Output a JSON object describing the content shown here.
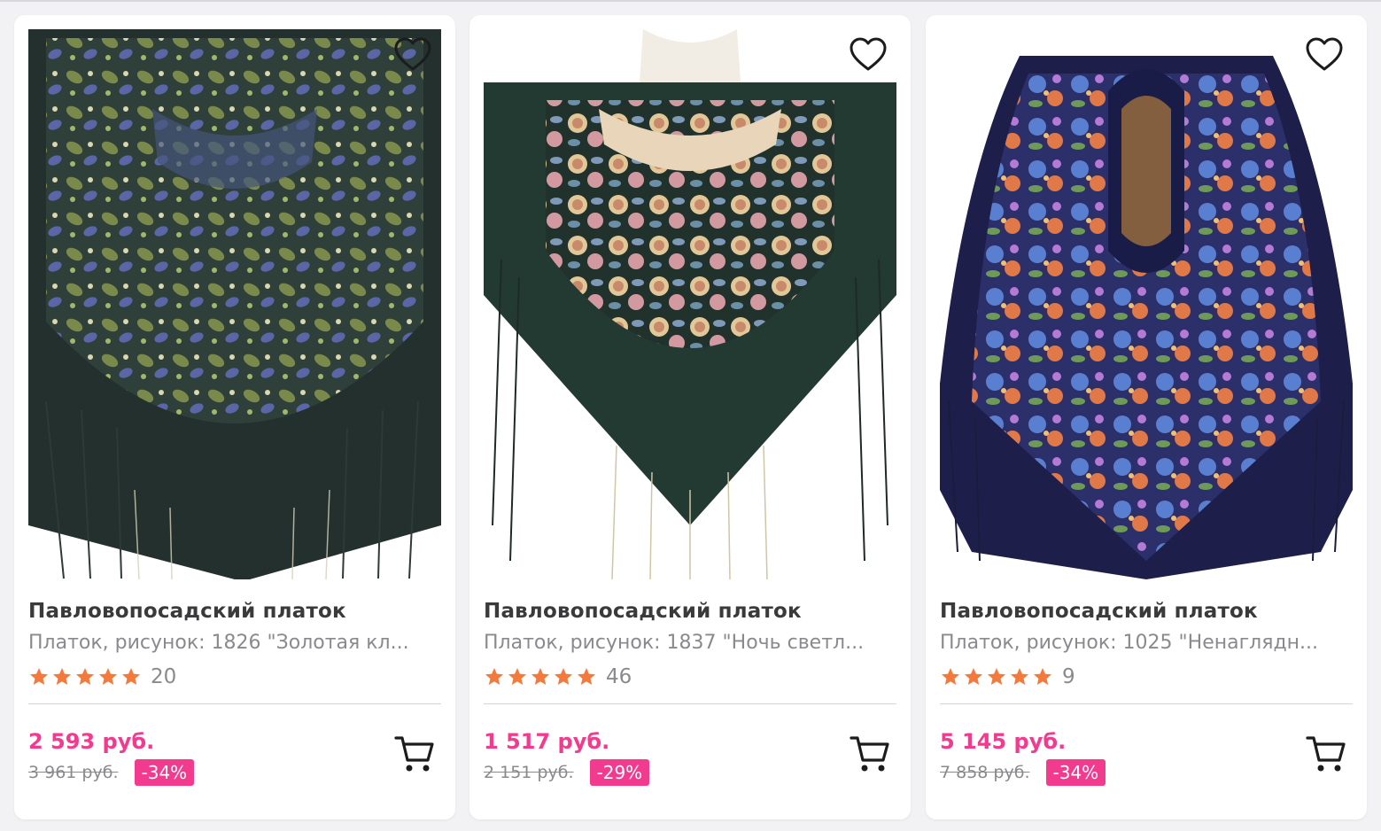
{
  "accent_color": "#f23a8f",
  "star_color": "#f47a3c",
  "products": [
    {
      "title": "Павловопосадский платок",
      "subtitle": "Платок, рисунок: 1826 \"Золотая кл...",
      "rating": 5,
      "reviews": "20",
      "price": "2 593 руб.",
      "old_price": "3 961 руб.",
      "discount": "-34%",
      "image_icon": "shawl-photo",
      "favorite_icon": "heart-icon",
      "cart_icon": "cart-icon"
    },
    {
      "title": "Павловопосадский платок",
      "subtitle": "Платок, рисунок: 1837 \"Ночь светл...",
      "rating": 5,
      "reviews": "46",
      "price": "1 517 руб.",
      "old_price": "2 151 руб.",
      "discount": "-29%",
      "image_icon": "shawl-photo",
      "favorite_icon": "heart-icon",
      "cart_icon": "cart-icon"
    },
    {
      "title": "Павловопосадский платок",
      "subtitle": "Платок, рисунок: 1025 \"Ненаглядн...",
      "rating": 5,
      "reviews": "9",
      "price": "5 145 руб.",
      "old_price": "7 858 руб.",
      "discount": "-34%",
      "image_icon": "shawl-photo",
      "favorite_icon": "heart-icon",
      "cart_icon": "cart-icon"
    }
  ]
}
